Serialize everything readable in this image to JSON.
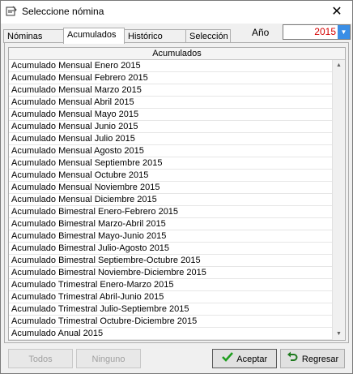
{
  "window": {
    "title": "Seleccione nómina",
    "close_glyph": "✕"
  },
  "tabs": [
    {
      "label": "Nóminas",
      "active": false
    },
    {
      "label": "Acumulados",
      "active": true
    },
    {
      "label": "Histórico",
      "active": false
    },
    {
      "label": "Selección",
      "active": false
    }
  ],
  "year": {
    "label": "Año",
    "value": "2015"
  },
  "grid": {
    "header": "Acumulados",
    "rows": [
      "Acumulado Mensual Enero 2015",
      "Acumulado Mensual Febrero 2015",
      "Acumulado Mensual Marzo 2015",
      "Acumulado Mensual Abril 2015",
      "Acumulado Mensual Mayo 2015",
      "Acumulado Mensual Junio 2015",
      "Acumulado Mensual Julio 2015",
      "Acumulado Mensual Agosto 2015",
      "Acumulado Mensual Septiembre 2015",
      "Acumulado Mensual Octubre 2015",
      "Acumulado Mensual Noviembre 2015",
      "Acumulado Mensual Diciembre 2015",
      "Acumulado Bimestral Enero-Febrero 2015",
      "Acumulado Bimestral Marzo-Abril 2015",
      "Acumulado Bimestral Mayo-Junio 2015",
      "Acumulado Bimestral Julio-Agosto 2015",
      "Acumulado Bimestral Septiembre-Octubre 2015",
      "Acumulado Bimestral Noviembre-Diciembre 2015",
      "Acumulado Trimestral Enero-Marzo 2015",
      "Acumulado Trimestral Abril-Junio 2015",
      "Acumulado Trimestral Julio-Septiembre 2015",
      "Acumulado Trimestral Octubre-Diciembre 2015",
      "Acumulado Anual 2015"
    ]
  },
  "buttons": {
    "todos": "Todos",
    "ninguno": "Ninguno",
    "aceptar": "Aceptar",
    "regresar": "Regresar"
  },
  "colors": {
    "year_value": "#d40000",
    "dropdown_accent": "#3a8ee6",
    "accept_check": "#1e9e1e",
    "back_arrow": "#1e7a1e"
  }
}
